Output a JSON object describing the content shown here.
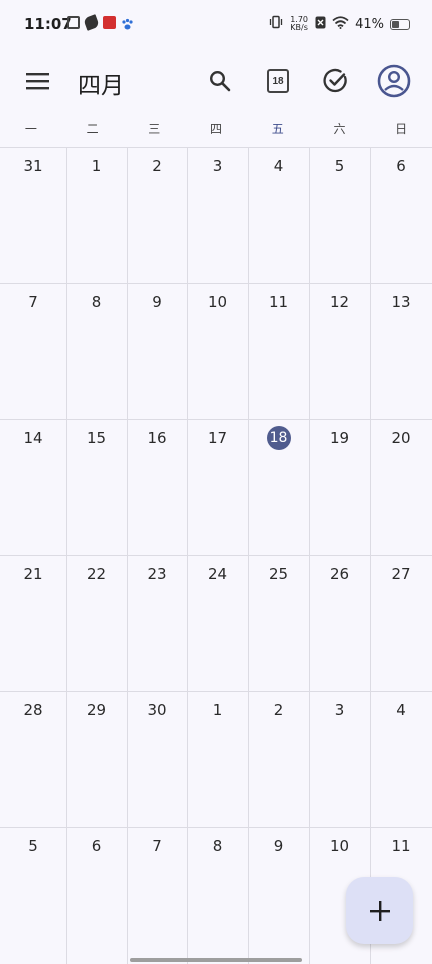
{
  "status_bar": {
    "time": "11:07",
    "net_speed_value": "1.70",
    "net_speed_unit": "KB/s",
    "battery_percent": "41%",
    "battery_level": 0.41,
    "icons": [
      "message-icon",
      "leaf-icon",
      "app-red-icon",
      "paw-icon",
      "vibrate-icon",
      "sim-off-icon",
      "wifi-icon",
      "battery-icon"
    ]
  },
  "appbar": {
    "title": "四月",
    "today_day": "18",
    "icons": [
      "menu-icon",
      "search-icon",
      "today-icon",
      "tasks-icon",
      "account-icon"
    ]
  },
  "weekdays": [
    "一",
    "二",
    "三",
    "四",
    "五",
    "六",
    "日"
  ],
  "today_weekday_index": 4,
  "calendar": {
    "weeks": [
      [
        "31",
        "1",
        "2",
        "3",
        "4",
        "5",
        "6"
      ],
      [
        "7",
        "8",
        "9",
        "10",
        "11",
        "12",
        "13"
      ],
      [
        "14",
        "15",
        "16",
        "17",
        "18",
        "19",
        "20"
      ],
      [
        "21",
        "22",
        "23",
        "24",
        "25",
        "26",
        "27"
      ],
      [
        "28",
        "29",
        "30",
        "1",
        "2",
        "3",
        "4"
      ],
      [
        "5",
        "6",
        "7",
        "8",
        "9",
        "10",
        "11"
      ]
    ],
    "today": {
      "week": 2,
      "day": 4
    }
  },
  "fab": {
    "icon": "plus-icon"
  },
  "colors": {
    "background": "#f8f7fd",
    "accent": "#505c8e",
    "fab": "#dde0f6",
    "grid": "#dcdbe3"
  }
}
